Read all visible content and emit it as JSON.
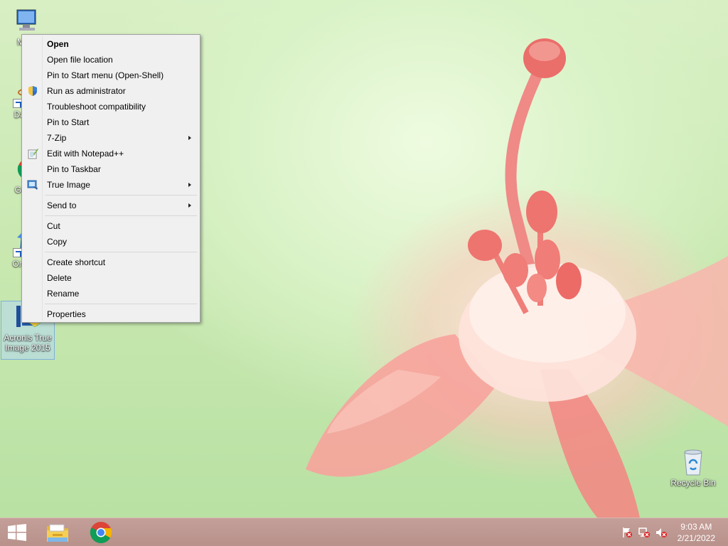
{
  "desktop_icons": [
    {
      "label": "My C",
      "icon": "computer-icon"
    },
    {
      "label": "DataW",
      "icon": "atom-app-icon"
    },
    {
      "label": "Go Ch",
      "icon": "chrome-icon"
    },
    {
      "label": "Ora Virt",
      "icon": "virtualbox-icon"
    },
    {
      "label": "Acronis True Image 2015",
      "icon": "acronis-icon"
    },
    {
      "label": "Recycle Bin",
      "icon": "recycle-bin-icon"
    }
  ],
  "context_menu": {
    "items": [
      {
        "label": "Open",
        "bold": true
      },
      {
        "label": "Open file location"
      },
      {
        "label": "Pin to Start menu (Open-Shell)"
      },
      {
        "label": "Run as administrator",
        "icon": "uac-shield-icon"
      },
      {
        "label": "Troubleshoot compatibility"
      },
      {
        "label": "Pin to Start"
      },
      {
        "label": "7-Zip",
        "submenu": true
      },
      {
        "label": "Edit with Notepad++",
        "icon": "notepadpp-icon"
      },
      {
        "label": "Pin to Taskbar"
      },
      {
        "label": "True Image",
        "icon": "true-image-icon",
        "submenu": true
      },
      {
        "label": "Send to",
        "submenu": true
      },
      {
        "label": "Cut"
      },
      {
        "label": "Copy"
      },
      {
        "label": "Create shortcut"
      },
      {
        "label": "Delete"
      },
      {
        "label": "Rename"
      },
      {
        "label": "Properties"
      }
    ]
  },
  "taskbar": {
    "start_icon": "windows-logo-icon",
    "pinned": [
      "file-explorer-icon",
      "chrome-icon"
    ],
    "tray": [
      "action-center-flag-icon",
      "network-icon",
      "volume-muted-icon"
    ],
    "time": "9:03 AM",
    "date": "2/21/2022"
  },
  "colors": {
    "taskbar": "#bf9892",
    "menu_bg": "#f0f0f0",
    "selection": "#b4d7f5"
  }
}
